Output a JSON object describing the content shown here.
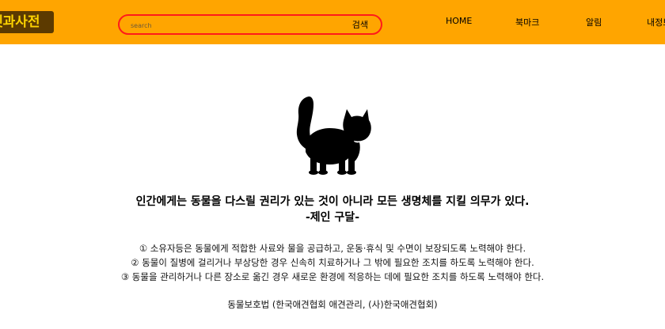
{
  "header": {
    "logo_text": "펫과사전",
    "search": {
      "placeholder": "search",
      "value": "",
      "button_label": "검색"
    },
    "nav": [
      {
        "label": "HOME"
      },
      {
        "label": "북마크"
      },
      {
        "label": "알림"
      },
      {
        "label": "내정보"
      }
    ]
  },
  "main": {
    "image_icon": "black-cat-silhouette",
    "headline_line1": "인간에게는 동물을 다스릴 권리가 있는 것이 아니라 모든 생명체를 지킬 의무가 있다.",
    "headline_line2": "-제인 구달-",
    "rules": [
      "① 소유자등은 동물에게 적합한 사료와 물을 공급하고, 운동·휴식 및 수면이 보장되도록 노력해야 한다.",
      "② 동물이 질병에 걸리거나 부상당한 경우 신속히 치료하거나 그 밖에 필요한 조치를 하도록 노력해야 한다.",
      "③ 동물을 관리하거나 다른 장소로 옮긴 경우 새로운 환경에 적응하는 데에 필요한 조치를 하도록 노력해야 한다."
    ],
    "source": "동물보호법 (한국애견협회 애견관리, (사)한국애견협회)"
  },
  "colors": {
    "header_bg": "#ffa500",
    "search_border": "#ff1a1a",
    "logo_bg": "#5c3a00",
    "logo_text": "#ffd400"
  }
}
